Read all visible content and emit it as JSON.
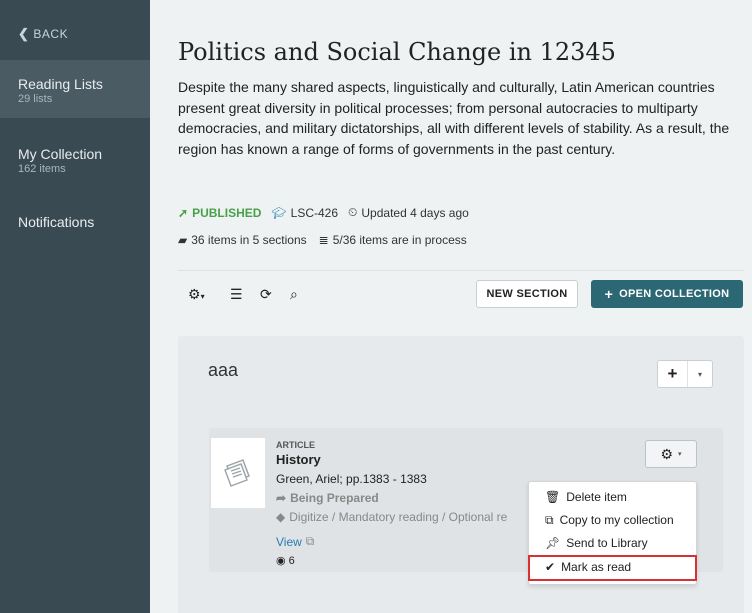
{
  "sidebar": {
    "back_label": "BACK",
    "items": [
      {
        "title": "Reading Lists",
        "sub": "29 lists"
      },
      {
        "title": "My Collection",
        "sub": "162 items"
      },
      {
        "title": "Notifications"
      }
    ]
  },
  "header": {
    "title": "Politics and Social Change in 12345",
    "description": "Despite the many shared aspects, linguistically and culturally, Latin American countries present great diversity in political processes; from personal autocracies to multiparty democracies, and military dictatorships, all with different levels of stability. As a result, the region has known a range of forms of governments in the past century.",
    "status": "PUBLISHED",
    "course_code": "LSC-426",
    "updated": "Updated 4 days ago",
    "items_summary": "36 items in 5 sections",
    "process_summary": "5/36 items are in process"
  },
  "toolbar": {
    "new_section_label": "NEW SECTION",
    "open_collection_label": "OPEN COLLECTION"
  },
  "section": {
    "title": "aaa",
    "item": {
      "type": "ARTICLE",
      "title": "History",
      "author": "Green, Ariel; pp.1383 - 1383",
      "status": "Being Prepared",
      "tags": "Digitize / Mandatory reading / Optional re",
      "view_label": "View",
      "views": "6"
    }
  },
  "menu": {
    "items": [
      "Delete item",
      "Copy to my collection",
      "Send to Library",
      "Mark as read"
    ]
  },
  "colors": {
    "sidebar": "#3a4a52",
    "primary_button": "#2c6874",
    "published": "#4aa04a",
    "highlight": "#d93030"
  }
}
